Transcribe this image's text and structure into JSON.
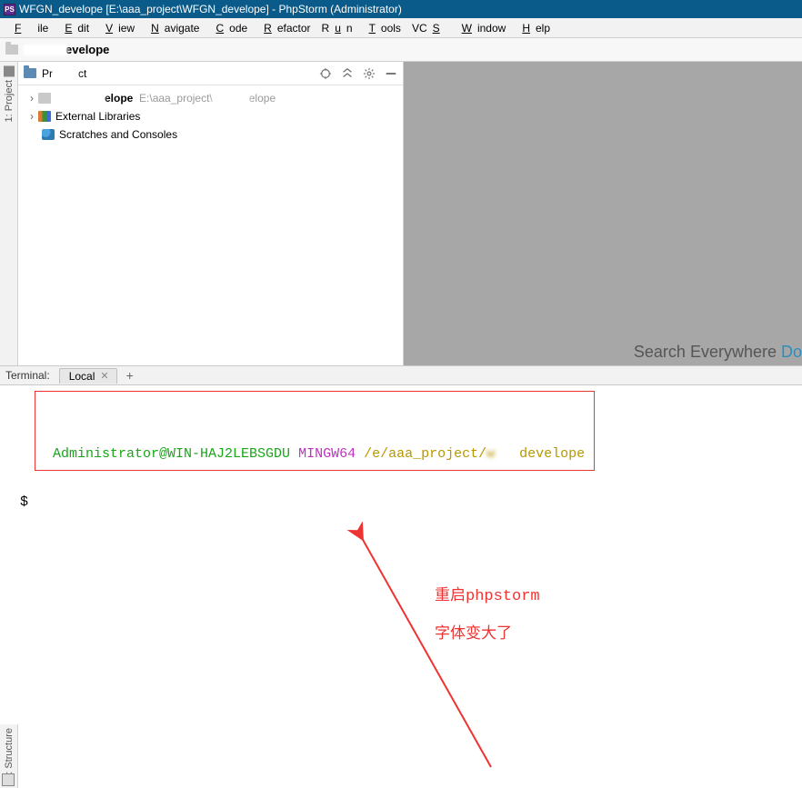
{
  "window": {
    "title": "WFGN_develope [E:\\aaa_project\\WFGN_develope] - PhpStorm (Administrator)",
    "app_icon_label": "PS"
  },
  "menu": {
    "file": "File",
    "edit": "Edit",
    "view": "View",
    "navigate": "Navigate",
    "code": "Code",
    "refactor": "Refactor",
    "run": "Run",
    "tools": "Tools",
    "vcs": "VCS",
    "window": "Window",
    "help": "Help"
  },
  "breadcrumb": {
    "suffix": "evelope"
  },
  "sidebar_tools": {
    "project": "1: Project",
    "structure": "7: Structure"
  },
  "project_panel": {
    "header_prefix": "Pr",
    "header_suffix": "ct",
    "tree": [
      {
        "kind": "module",
        "name_suffix": "elope",
        "path_prefix": "E:\\aaa_project\\",
        "path_suffix": "elope"
      },
      {
        "kind": "libs",
        "label": "External Libraries"
      },
      {
        "kind": "scratch",
        "label": "Scratches and Consoles"
      }
    ]
  },
  "editor": {
    "search_hint_prefix": "Search Everywhere ",
    "search_hint_action": "Do"
  },
  "terminal": {
    "panel_label": "Terminal:",
    "tab_label": "Local",
    "prompt_user_host": "Administrator@WIN-HAJ2LEBSGDU",
    "prompt_shell": "MINGW64",
    "prompt_path_prefix": "/e/aaa_project/",
    "prompt_path_hidden": "w",
    "prompt_path_suffix": "develope",
    "prompt_symbol": "$"
  },
  "annotations": {
    "line1": "重启phpstorm",
    "line2": "字体变大了"
  }
}
